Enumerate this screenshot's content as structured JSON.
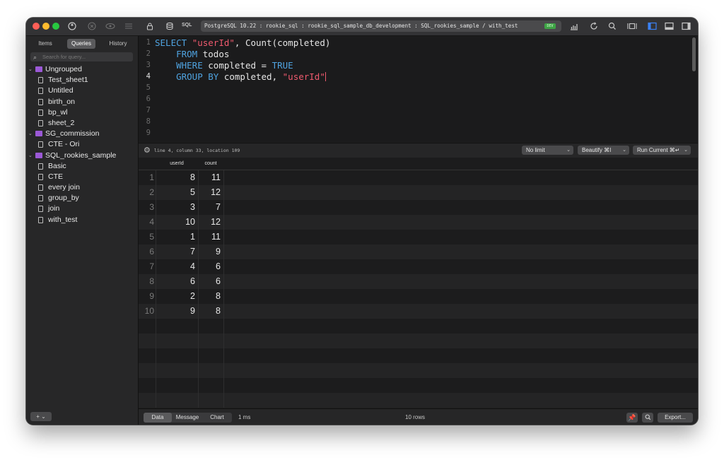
{
  "toolbar": {
    "sql_tag": "SQL",
    "connection": "PostgreSQL 10.22 : rookie_sql : rookie_sql_sample_db_development : SQL_rookies_sample / with_test",
    "connection_badge": "DEV",
    "icons": [
      "connection-icon",
      "close-circle-icon",
      "eye-icon",
      "list-icon",
      "lock-icon",
      "database-icon",
      "chart-icon",
      "refresh-icon",
      "search-icon",
      "columns-icon",
      "left-panel-icon",
      "bottom-panel-icon",
      "right-panel-icon"
    ]
  },
  "sidebar": {
    "tabs": [
      {
        "label": "Items"
      },
      {
        "label": "Queries"
      },
      {
        "label": "History"
      }
    ],
    "active_tab": "Queries",
    "search_placeholder": "Search for query...",
    "groups": [
      {
        "name": "Ungrouped",
        "items": [
          "Test_sheet1",
          "Untitled",
          "birth_on",
          "bp_wl",
          "sheet_2"
        ]
      },
      {
        "name": "SG_commission",
        "items": [
          "CTE - Ori"
        ]
      },
      {
        "name": "SQL_rookies_sample",
        "items": [
          "Basic",
          "CTE",
          "every join",
          "group_by",
          "join",
          "with_test"
        ]
      }
    ],
    "footer_add": "+ ⌄"
  },
  "editor": {
    "line_numbers": [
      "1",
      "2",
      "3",
      "4",
      "5",
      "6",
      "7",
      "8",
      "9"
    ],
    "current_line": 4,
    "lines": [
      [
        {
          "t": "SELECT ",
          "c": "kw"
        },
        {
          "t": "\"userId\"",
          "c": "str"
        },
        {
          "t": ", Count(completed)",
          "c": ""
        }
      ],
      [
        {
          "t": "    ",
          "c": ""
        },
        {
          "t": "FROM",
          "c": "kw"
        },
        {
          "t": " todos",
          "c": ""
        }
      ],
      [
        {
          "t": "    ",
          "c": ""
        },
        {
          "t": "WHERE",
          "c": "kw"
        },
        {
          "t": " completed = ",
          "c": ""
        },
        {
          "t": "TRUE",
          "c": "kw"
        }
      ],
      [
        {
          "t": "    ",
          "c": ""
        },
        {
          "t": "GROUP BY",
          "c": "kw"
        },
        {
          "t": " completed, ",
          "c": ""
        },
        {
          "t": "\"userId\"",
          "c": "str"
        }
      ]
    ]
  },
  "status": {
    "position": "line 4, column 33, location 109",
    "limit": "No limit",
    "beautify": "Beautify ⌘I",
    "run": "Run Current ⌘↵"
  },
  "results": {
    "columns": [
      "userId",
      "count"
    ],
    "rows": [
      [
        "1",
        "8",
        "11"
      ],
      [
        "2",
        "5",
        "12"
      ],
      [
        "3",
        "3",
        "7"
      ],
      [
        "4",
        "10",
        "12"
      ],
      [
        "5",
        "1",
        "11"
      ],
      [
        "6",
        "7",
        "9"
      ],
      [
        "7",
        "4",
        "6"
      ],
      [
        "8",
        "6",
        "6"
      ],
      [
        "9",
        "2",
        "8"
      ],
      [
        "10",
        "9",
        "8"
      ]
    ]
  },
  "bottom": {
    "tabs": [
      "Data",
      "Message",
      "Chart"
    ],
    "active_tab": "Data",
    "time": "1 ms",
    "row_count": "10 rows",
    "export": "Export..."
  },
  "colors": {
    "keyword": "#4fa3e0",
    "string": "#ef5a6e",
    "folder": "#9b59d6",
    "accent": "#3b82f6"
  }
}
